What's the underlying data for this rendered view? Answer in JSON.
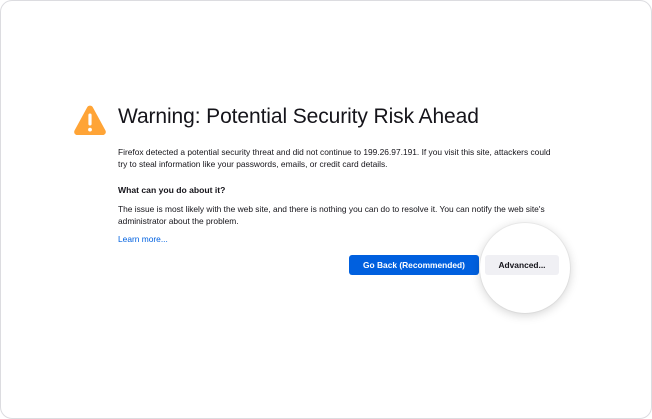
{
  "page": {
    "title": "Warning: Potential Security Risk Ahead",
    "description": "Firefox detected a potential security threat and did not continue to 199.26.97.191. If you visit this site, attackers could try to steal information like your passwords, emails, or credit card details.",
    "subheading": "What can you do about it?",
    "explanation": "The issue is most likely with the web site, and there is nothing you can do to resolve it. You can notify the web site's administrator about the problem.",
    "learn_more": "Learn more...",
    "go_back_label": "Go Back (Recommended)",
    "advanced_label": "Advanced..."
  },
  "icons": {
    "warning": "warning-triangle-icon"
  },
  "colors": {
    "warning": "#ffa436",
    "primary_button": "#0060df",
    "link": "#0061e0",
    "secondary_button": "#f0f0f4",
    "text": "#15141a"
  }
}
